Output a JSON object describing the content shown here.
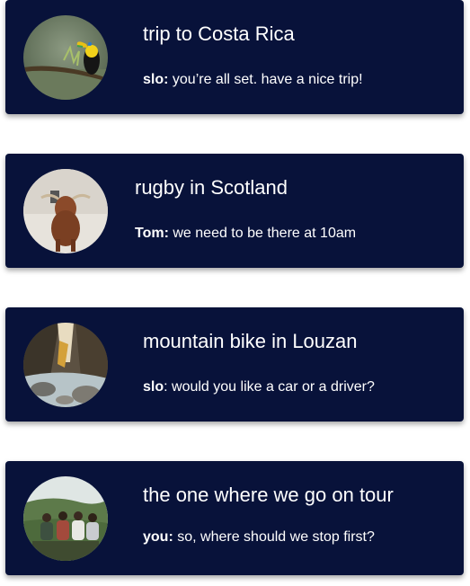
{
  "conversations": [
    {
      "title": "trip to Costa Rica",
      "sender": "slo:",
      "message": " you’re all set. have a nice trip!",
      "avatar_icon": "toucan-photo"
    },
    {
      "title": "rugby in Scotland",
      "sender": "Tom:",
      "message": " we need to be there at 10am",
      "avatar_icon": "highland-cow-photo"
    },
    {
      "title": "mountain bike in Louzan",
      "sender": "slo",
      "message": ": would you like a car or a driver?",
      "avatar_icon": "river-canyon-photo"
    },
    {
      "title": "the one where we go on tour",
      "sender": "you:",
      "message": " so, where should we stop first?",
      "avatar_icon": "friends-hillside-photo"
    }
  ],
  "colors": {
    "card_background": "#08123a",
    "text": "#ffffff"
  }
}
